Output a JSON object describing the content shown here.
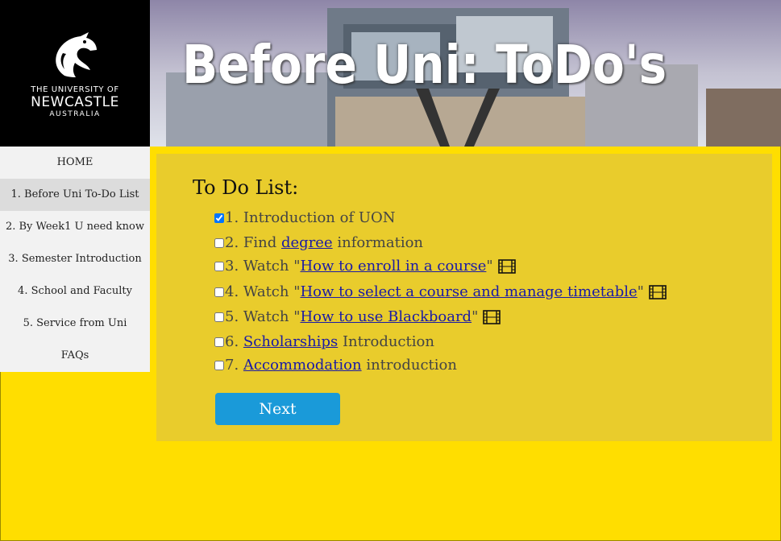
{
  "header": {
    "logo": {
      "line1": "THE UNIVERSITY OF",
      "line2": "NEWCASTLE",
      "line3": "AUSTRALIA"
    },
    "banner_title": "Before Uni: ToDo's"
  },
  "sidebar": {
    "items": [
      {
        "label": "HOME",
        "active": false
      },
      {
        "label": "1. Before Uni To-Do List",
        "active": true
      },
      {
        "label": "2. By Week1 U need know",
        "active": false
      },
      {
        "label": "3. Semester Introduction",
        "active": false
      },
      {
        "label": "4. School and Faculty",
        "active": false
      },
      {
        "label": "5. Service from Uni",
        "active": false
      },
      {
        "label": "FAQs",
        "active": false
      }
    ]
  },
  "todo": {
    "title": "To Do List:",
    "items": [
      {
        "prefix": "1. Introduction of UON",
        "link": "",
        "suffix": "",
        "checked": true,
        "video": false
      },
      {
        "prefix": "2. Find ",
        "link": "degree",
        "suffix": " information",
        "checked": false,
        "video": false
      },
      {
        "prefix": "3. Watch \"",
        "link": "How to enroll in a course",
        "suffix": "\"",
        "checked": false,
        "video": true
      },
      {
        "prefix": "4. Watch \"",
        "link": "How to select a course and manage timetable",
        "suffix": "\"",
        "checked": false,
        "video": true
      },
      {
        "prefix": "5. Watch \"",
        "link": "How to use Blackboard",
        "suffix": "\"",
        "checked": false,
        "video": true
      },
      {
        "prefix": "6. ",
        "link": "Scholarships",
        "suffix": " Introduction",
        "checked": false,
        "video": false
      },
      {
        "prefix": "7. ",
        "link": "Accommodation",
        "suffix": " introduction",
        "checked": false,
        "video": false
      }
    ],
    "next_label": "Next"
  },
  "colors": {
    "page_bg": "#ffde00",
    "panel_bg": "#e9cc2c",
    "button": "#1a9ad9",
    "link": "#1a1aa6"
  },
  "icons": {
    "video": "film-icon",
    "logo": "newcastle-seahorse-logo"
  }
}
